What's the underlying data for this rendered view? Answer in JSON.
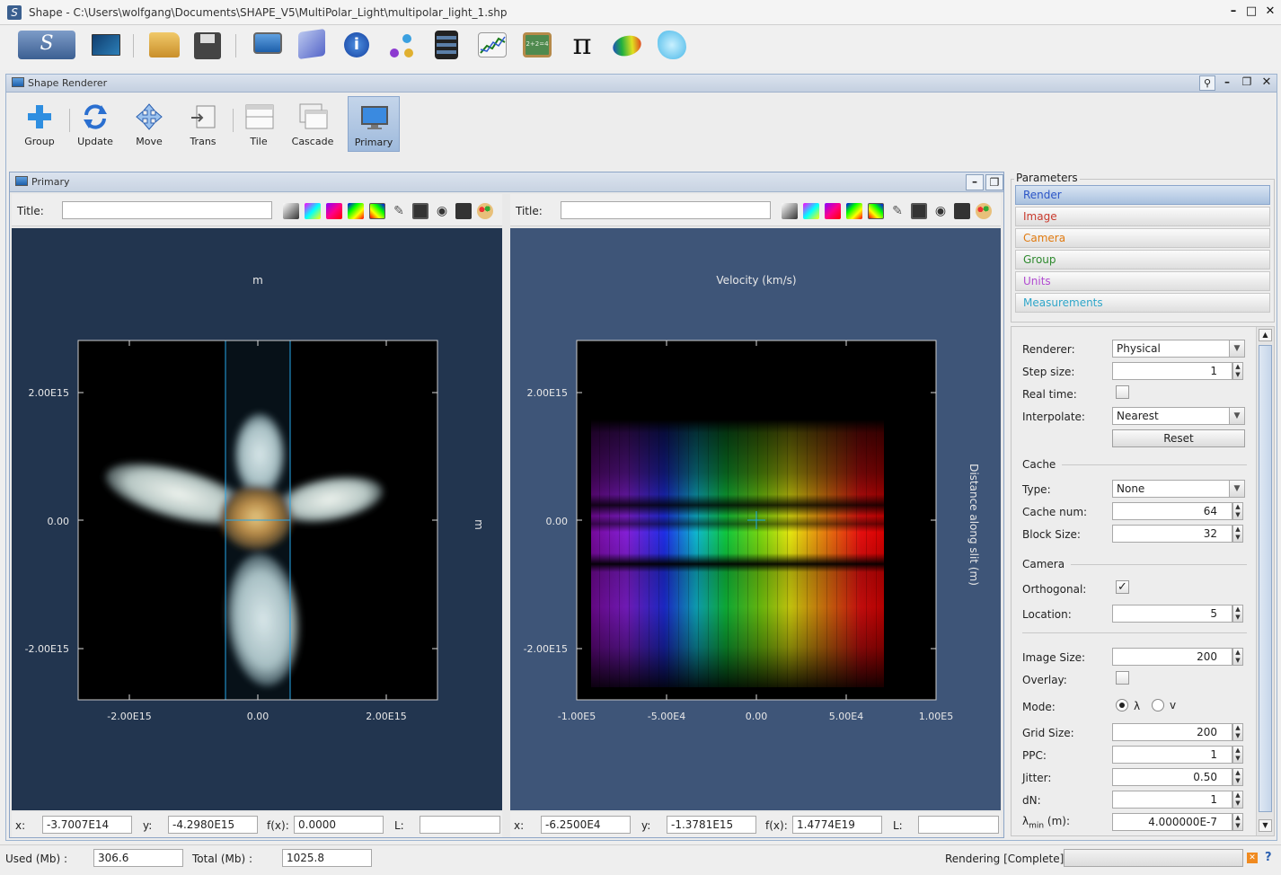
{
  "window": {
    "title": "Shape - C:\\Users\\wolfgang\\Documents\\SHAPE_V5\\MultiPolar_Light\\multipolar_light_1.shp"
  },
  "main_toolbar": {
    "icons": [
      "shape-logo-icon",
      "render-display-icon",
      "folder-open-icon",
      "save-disk-icon",
      "monitor-icon",
      "cube-icon",
      "info-icon",
      "molecule-icon",
      "film-icon",
      "chart-icon",
      "chalkboard-icon",
      "pi-icon",
      "ellipsoid-icon",
      "splash-icon"
    ]
  },
  "renderer_window": {
    "title": "Shape Renderer",
    "tools": [
      {
        "label": "Group",
        "icon": "plus-icon"
      },
      {
        "label": "Update",
        "icon": "refresh-icon"
      },
      {
        "label": "Move",
        "icon": "move-arrows-icon"
      },
      {
        "label": "Trans",
        "icon": "transform-icon"
      },
      {
        "label": "Tile",
        "icon": "tile-windows-icon"
      },
      {
        "label": "Cascade",
        "icon": "cascade-windows-icon"
      },
      {
        "label": "Primary",
        "icon": "monitor-icon"
      }
    ]
  },
  "primary": {
    "title": "Primary",
    "left": {
      "title_label": "Title:",
      "title_value": "",
      "top_label": "m",
      "right_label": "m",
      "x_ticks": [
        "-2.00E15",
        "0.00",
        "2.00E15"
      ],
      "y_ticks": [
        "2.00E15",
        "0.00",
        "-2.00E15"
      ],
      "coords": {
        "x_label": "x:",
        "x": "-3.7007E14",
        "y_label": "y:",
        "y": "-4.2980E15",
        "f_label": "f(x):",
        "f": "0.0000",
        "L_label": "L:",
        "L": ""
      }
    },
    "right": {
      "title_label": "Title:",
      "title_value": "",
      "top_label": "Velocity (km/s)",
      "right_label": "Distance along slit (m)",
      "x_ticks": [
        "-1.00E5",
        "-5.00E4",
        "0.00",
        "5.00E4",
        "1.00E5"
      ],
      "y_ticks": [
        "2.00E15",
        "0.00",
        "-2.00E15"
      ],
      "coords": {
        "x_label": "x:",
        "x": "-6.2500E4",
        "y_label": "y:",
        "y": "-1.3781E15",
        "f_label": "f(x):",
        "f": "1.4774E19",
        "L_label": "L:",
        "L": ""
      }
    }
  },
  "parameters": {
    "legend": "Parameters",
    "tabs": [
      {
        "label": "Render",
        "color": "#2b55c7"
      },
      {
        "label": "Image",
        "color": "#c93a2d"
      },
      {
        "label": "Camera",
        "color": "#e07a10"
      },
      {
        "label": "Group",
        "color": "#2f8a2f"
      },
      {
        "label": "Units",
        "color": "#b14bd1"
      },
      {
        "label": "Measurements",
        "color": "#2fa6c9"
      }
    ],
    "form": {
      "renderer_label": "Renderer:",
      "renderer": "Physical",
      "step_label": "Step size:",
      "step": "1",
      "realtime_label": "Real time:",
      "interp_label": "Interpolate:",
      "interp": "Nearest",
      "reset": "Reset",
      "cache_section": "Cache",
      "type_label": "Type:",
      "type": "None",
      "cachenum_label": "Cache num:",
      "cachenum": "64",
      "block_label": "Block Size:",
      "block": "32",
      "camera_section": "Camera",
      "ortho_label": "Orthogonal:",
      "location_label": "Location:",
      "location": "5",
      "imgsize_label": "Image Size:",
      "imgsize": "200",
      "overlay_label": "Overlay:",
      "mode_label": "Mode:",
      "mode_a": "λ",
      "mode_b": "v",
      "grid_label": "Grid Size:",
      "grid": "200",
      "ppc_label": "PPC:",
      "ppc": "1",
      "jitter_label": "Jitter:",
      "jitter": "0.50",
      "dn_label": "dN:",
      "dn": "1",
      "lmin_label": "λ",
      "lmin_sub": "min",
      "lmin_unit": " (m):",
      "lmin": "4.000000E-7"
    }
  },
  "status": {
    "used_label": "Used (Mb) :",
    "used": "306.6",
    "total_label": "Total (Mb) :",
    "total": "1025.8",
    "render_status": "Rendering [Complete]"
  }
}
